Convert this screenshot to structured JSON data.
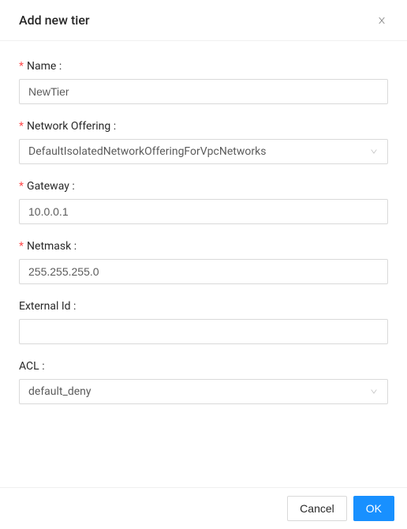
{
  "modal": {
    "title": "Add new tier"
  },
  "form": {
    "name": {
      "label": "Name",
      "required": true,
      "value": "NewTier"
    },
    "networkOffering": {
      "label": "Network Offering",
      "required": true,
      "value": "DefaultIsolatedNetworkOfferingForVpcNetworks"
    },
    "gateway": {
      "label": "Gateway",
      "required": true,
      "value": "10.0.0.1"
    },
    "netmask": {
      "label": "Netmask",
      "required": true,
      "value": "255.255.255.0"
    },
    "externalId": {
      "label": "External Id",
      "required": false,
      "value": ""
    },
    "acl": {
      "label": "ACL",
      "required": false,
      "value": "default_deny"
    }
  },
  "footer": {
    "cancel": "Cancel",
    "ok": "OK"
  }
}
